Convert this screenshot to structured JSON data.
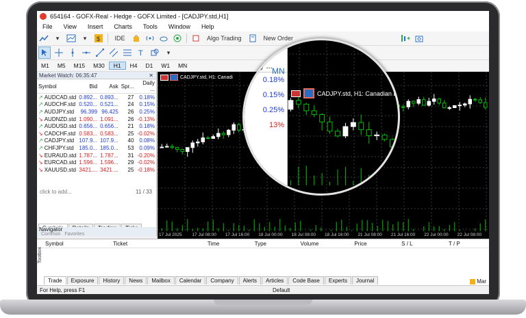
{
  "window": {
    "title": "654164 - GOFX-Real - Hedge - GOFX Limited - [CADJPY.std,H1]"
  },
  "menu": [
    "File",
    "View",
    "Insert",
    "Charts",
    "Tools",
    "Window",
    "Help"
  ],
  "toolbar": {
    "ide": "IDE",
    "algo": "Algo Trading",
    "new_order": "New Order"
  },
  "timeframes": [
    "M1",
    "M5",
    "M15",
    "M30",
    "H1",
    "H4",
    "D1",
    "W1",
    "MN"
  ],
  "active_timeframe": "H1",
  "market_watch": {
    "title": "Market Watch: 06:35:47",
    "columns": [
      "Symbol",
      "Bid",
      "Ask",
      "Spr...",
      "Daily ..."
    ],
    "rows": [
      {
        "symbol": "AUDCAD.std",
        "bid": "0.892...",
        "ask": "0.893...",
        "spread": "27",
        "daily": "0.18%",
        "dir": "up"
      },
      {
        "symbol": "AUDCHF.std",
        "bid": "0.520...",
        "ask": "0.521...",
        "spread": "24",
        "daily": "0.15%",
        "dir": "up"
      },
      {
        "symbol": "AUDJPY.std",
        "bid": "96.399",
        "ask": "96.425",
        "spread": "26",
        "daily": "0.25%",
        "dir": "up"
      },
      {
        "symbol": "AUDNZD.std",
        "bid": "1.090...",
        "ask": "1.091...",
        "spread": "26",
        "daily": "-0.13%",
        "dir": "down"
      },
      {
        "symbol": "AUDUSD.std",
        "bid": "0.656...",
        "ask": "0.656...",
        "spread": "21",
        "daily": "0.18%",
        "dir": "up"
      },
      {
        "symbol": "CADCHF.std",
        "bid": "0.583...",
        "ask": "0.583...",
        "spread": "25",
        "daily": "-0.02%",
        "dir": "down"
      },
      {
        "symbol": "CADJPY.std",
        "bid": "107.9...",
        "ask": "107.9...",
        "spread": "40",
        "daily": "0.08%",
        "dir": "up"
      },
      {
        "symbol": "CHFJPY.std",
        "bid": "185.0...",
        "ask": "185.0...",
        "spread": "53",
        "daily": "0.09%",
        "dir": "up"
      },
      {
        "symbol": "EURAUD.std",
        "bid": "1.787...",
        "ask": "1.787...",
        "spread": "31",
        "daily": "-0.20%",
        "dir": "down"
      },
      {
        "symbol": "EURCAD.std",
        "bid": "1.596...",
        "ask": "1.596...",
        "spread": "29",
        "daily": "-0.02%",
        "dir": "down"
      },
      {
        "symbol": "XAUUSD.std",
        "bid": "3421....",
        "ask": "3421....",
        "spread": "25",
        "daily": "-0.18%",
        "dir": "down"
      }
    ],
    "add_placeholder": "click to add...",
    "count": "11 / 33",
    "tabs": [
      "Symbols",
      "Details",
      "Trading",
      "Ticks"
    ]
  },
  "navigator": {
    "title": "Navigator",
    "tabs": [
      "Common",
      "Favorites"
    ]
  },
  "chart": {
    "title": "CADJPY.std, H1:  Canadian Do",
    "small_title": "CADJPY.std, H1:  Canadi",
    "x_labels": [
      "17 Jul 2025",
      "17 Jul 08:00",
      "17 Jul 16:00",
      "18 Jul 00:00",
      "18 Jul 08:00",
      "18 Jul 16:00",
      "21 Jul 08:00",
      "21 Jul 16:00",
      "22 Jul 00:00",
      "22 Jul 08:00"
    ]
  },
  "magnifier": {
    "header": "Daily ...",
    "values": [
      "0.18%",
      "0.15%",
      "0.25%",
      "13%"
    ],
    "timeframe": "MN"
  },
  "terminal": {
    "columns": [
      "Symbol",
      "Ticket",
      "Time",
      "Type",
      "Volume",
      "Price",
      "S / L",
      "T / P"
    ],
    "tabs": [
      "Trade",
      "Exposure",
      "History",
      "News",
      "Mailbox",
      "Calendar",
      "Company",
      "Alerts",
      "Articles",
      "Code Base",
      "Experts",
      "Journal"
    ],
    "market": "Mar",
    "toolbox": "Toolbox"
  },
  "status": {
    "help": "For Help, press F1",
    "profile": "Default"
  },
  "colors": {
    "up": "#1e3ad8",
    "down": "#d81e1e",
    "candle_up": "#ffffff",
    "candle_down": "#00c000",
    "grid": "#3a3a3a"
  }
}
